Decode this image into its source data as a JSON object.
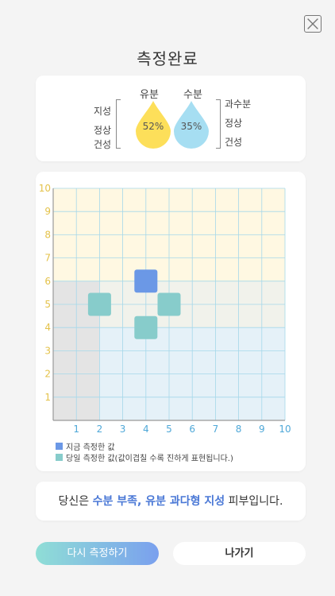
{
  "header": {
    "title": "측정완료",
    "close_label": "×"
  },
  "result": {
    "oil": {
      "label": "유분",
      "value": "52%",
      "color": "#fddf5a"
    },
    "water": {
      "label": "수분",
      "value": "35%",
      "color": "#a6def2"
    },
    "left_labels": {
      "high": "지성",
      "mid": "정상",
      "low": "건성"
    },
    "right_labels": {
      "high": "과수분",
      "mid": "정상",
      "low": "건성"
    }
  },
  "chart_data": {
    "type": "heatmap",
    "x_ticks": [
      "1",
      "2",
      "3",
      "4",
      "5",
      "6",
      "7",
      "8",
      "9",
      "10"
    ],
    "y_ticks": [
      "1",
      "2",
      "3",
      "4",
      "5",
      "6",
      "7",
      "8",
      "9",
      "10"
    ],
    "xlim": [
      0,
      10
    ],
    "ylim": [
      0,
      10
    ],
    "grid": true,
    "current": [
      {
        "x": 4,
        "y": 6
      }
    ],
    "same_day": [
      {
        "x": 2,
        "y": 5
      },
      {
        "x": 4,
        "y": 4
      },
      {
        "x": 5,
        "y": 5
      }
    ],
    "colors": {
      "current": "#6b98e6",
      "same_day": "#87cccb",
      "top_zone": "#fff8e2",
      "mid_zone": "#f1f2eb",
      "right_zone": "#e5f1f8",
      "left_zone": "#e4e4e4",
      "grid": "#a5d8ea",
      "y_tick": "#e4c24a",
      "x_tick": "#4fa8d8"
    }
  },
  "legend": {
    "current_label": "지금 측정한 값",
    "same_day_label": "당일 측정한 값(값이겹칠 수록 진하게 표현됩니다.)"
  },
  "summary": {
    "prefix": "당신은 ",
    "highlight": "수분 부족, 유분 과다형 지성",
    "suffix": " 피부입니다."
  },
  "buttons": {
    "retry": "다시 측정하기",
    "exit": "나가기"
  }
}
